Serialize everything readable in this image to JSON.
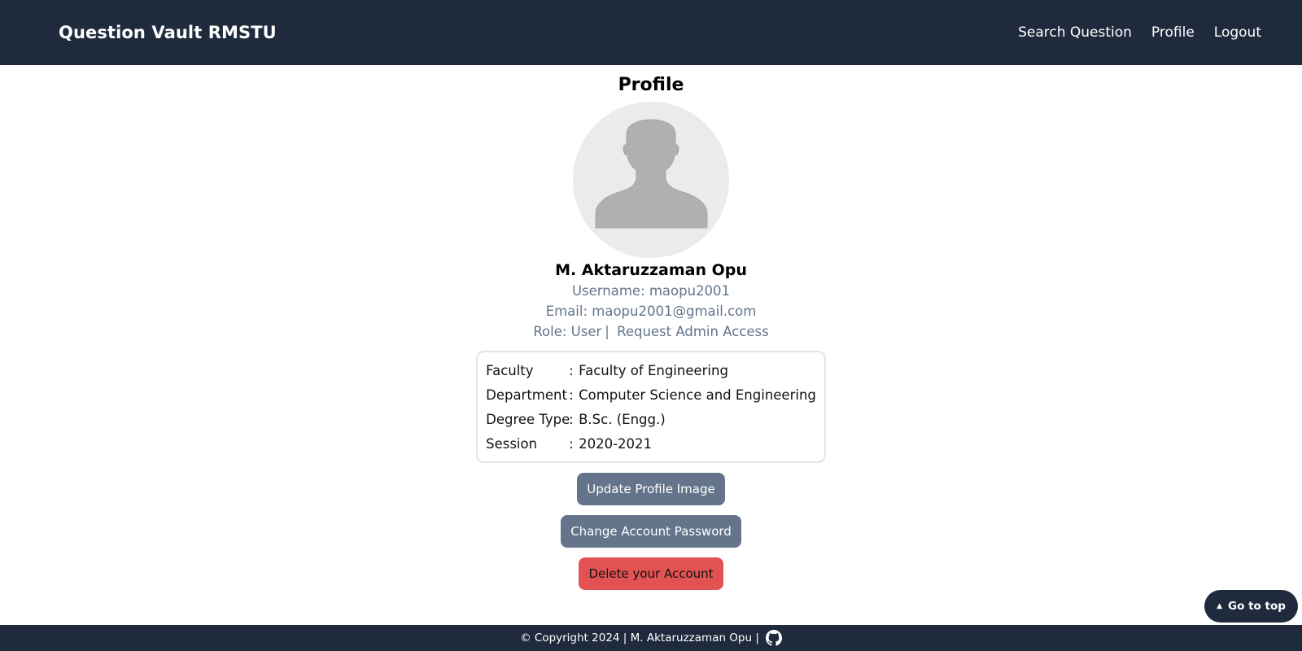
{
  "navbar": {
    "brand": "Question Vault RMSTU",
    "links": [
      "Search Question",
      "Profile",
      "Logout"
    ]
  },
  "profile": {
    "title": "Profile",
    "name": "M. Aktaruzzaman Opu",
    "username_line": "Username: maopu2001",
    "email_line": "Email: maopu2001@gmail.com",
    "role_line": "Role: User",
    "role_separator": "|",
    "request_admin": "Request Admin Access",
    "details": [
      {
        "label": "Faculty",
        "value": "Faculty of Engineering"
      },
      {
        "label": "Department",
        "value": "Computer Science and Engineering"
      },
      {
        "label": "Degree Type",
        "value": "B.Sc. (Engg.)"
      },
      {
        "label": "Session",
        "value": "2020-2021"
      }
    ],
    "colon": ":",
    "buttons": {
      "update_image": "Update Profile Image",
      "change_password": "Change Account Password",
      "delete_account": "Delete your Account"
    }
  },
  "footer": {
    "text": "© Copyright 2024 | M. Aktaruzzaman Opu |"
  },
  "goto_top": "Go to top",
  "colors": {
    "nav_bg": "#1f2a3c",
    "muted_text": "#64748b",
    "gray_button": "#64748b",
    "danger_button": "#e25252",
    "avatar_bg": "#ebebed",
    "avatar_silhouette": "#b0b0b0"
  },
  "icons": {
    "avatar": "user-silhouette-icon",
    "footer": "github-icon",
    "goto_top": "caret-up-icon"
  }
}
